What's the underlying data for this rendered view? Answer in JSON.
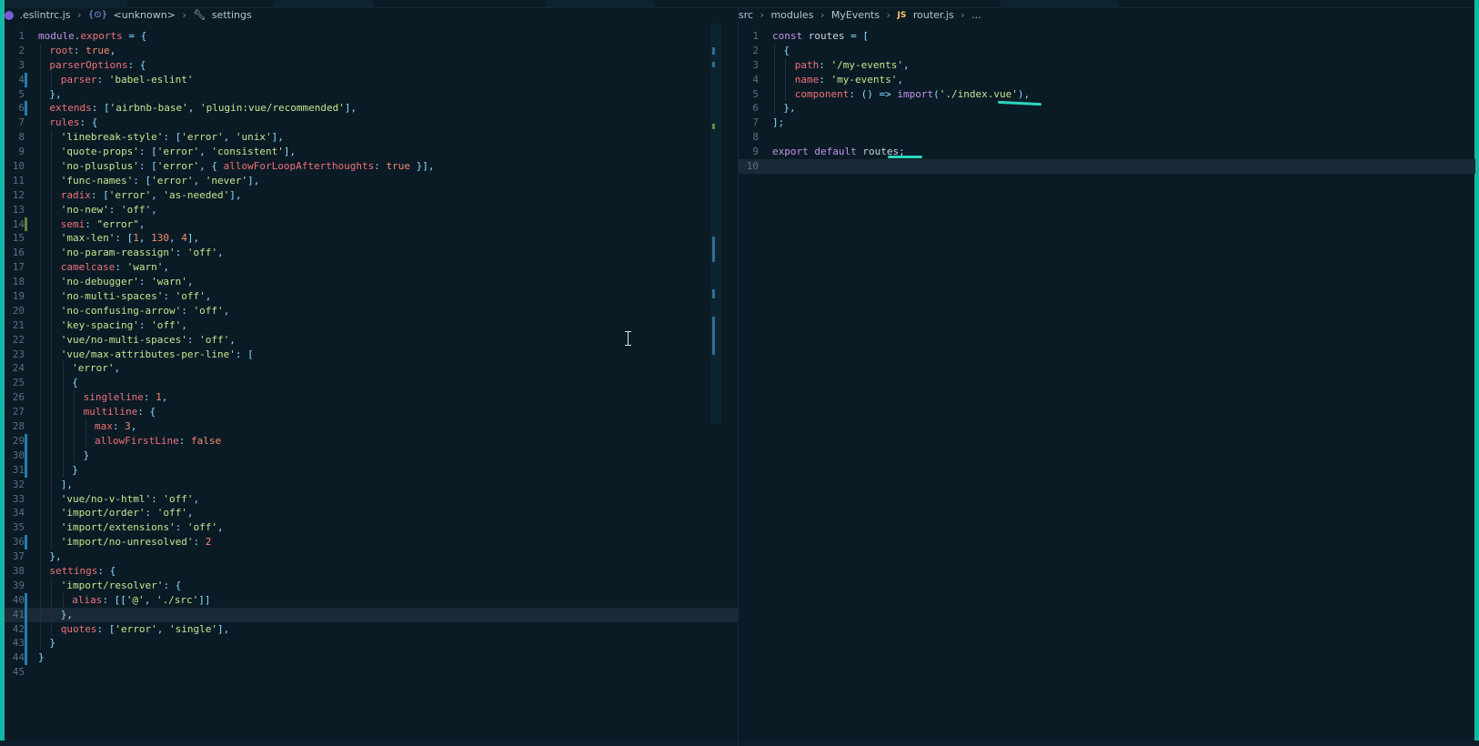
{
  "left_editor": {
    "breadcrumb": {
      "file": ".eslintrc.js",
      "symbol": "<unknown>",
      "subsymbol": "settings"
    },
    "lines": [
      {
        "num": "1",
        "indent": 0,
        "text": "module.exports = {"
      },
      {
        "num": "2",
        "indent": 1,
        "text": "root: true,"
      },
      {
        "num": "3",
        "indent": 1,
        "text": "parserOptions: {"
      },
      {
        "num": "4",
        "indent": 2,
        "text": "parser: 'babel-eslint'"
      },
      {
        "num": "5",
        "indent": 1,
        "text": "},"
      },
      {
        "num": "6",
        "indent": 1,
        "text": "extends: ['airbnb-base', 'plugin:vue/recommended'],"
      },
      {
        "num": "7",
        "indent": 1,
        "text": "rules: {"
      },
      {
        "num": "8",
        "indent": 2,
        "text": "'linebreak-style': ['error', 'unix'],"
      },
      {
        "num": "9",
        "indent": 2,
        "text": "'quote-props': ['error', 'consistent'],"
      },
      {
        "num": "10",
        "indent": 2,
        "text": "'no-plusplus': ['error', { allowForLoopAfterthoughts: true }],"
      },
      {
        "num": "11",
        "indent": 2,
        "text": "'func-names': ['error', 'never'],"
      },
      {
        "num": "12",
        "indent": 2,
        "text": "radix: ['error', 'as-needed'],"
      },
      {
        "num": "13",
        "indent": 2,
        "text": "'no-new': 'off',"
      },
      {
        "num": "14",
        "indent": 2,
        "text": "semi: \"error\","
      },
      {
        "num": "15",
        "indent": 2,
        "text": "'max-len': [1, 130, 4],"
      },
      {
        "num": "16",
        "indent": 2,
        "text": "'no-param-reassign': 'off',"
      },
      {
        "num": "17",
        "indent": 2,
        "text": "camelcase: 'warn',"
      },
      {
        "num": "18",
        "indent": 2,
        "text": "'no-debugger': 'warn',"
      },
      {
        "num": "19",
        "indent": 2,
        "text": "'no-multi-spaces': 'off',"
      },
      {
        "num": "20",
        "indent": 2,
        "text": "'no-confusing-arrow': 'off',"
      },
      {
        "num": "21",
        "indent": 2,
        "text": "'key-spacing': 'off',"
      },
      {
        "num": "22",
        "indent": 2,
        "text": "'vue/no-multi-spaces': 'off',"
      },
      {
        "num": "23",
        "indent": 2,
        "text": "'vue/max-attributes-per-line': ["
      },
      {
        "num": "24",
        "indent": 3,
        "text": "'error',"
      },
      {
        "num": "25",
        "indent": 3,
        "text": "{"
      },
      {
        "num": "26",
        "indent": 4,
        "text": "singleline: 1,"
      },
      {
        "num": "27",
        "indent": 4,
        "text": "multiline: {"
      },
      {
        "num": "28",
        "indent": 5,
        "text": "max: 3,"
      },
      {
        "num": "29",
        "indent": 5,
        "text": "allowFirstLine: false"
      },
      {
        "num": "30",
        "indent": 4,
        "text": "}"
      },
      {
        "num": "31",
        "indent": 3,
        "text": "}"
      },
      {
        "num": "32",
        "indent": 2,
        "text": "],"
      },
      {
        "num": "33",
        "indent": 2,
        "text": "'vue/no-v-html': 'off',"
      },
      {
        "num": "34",
        "indent": 2,
        "text": "'import/order': 'off',"
      },
      {
        "num": "35",
        "indent": 2,
        "text": "'import/extensions': 'off',"
      },
      {
        "num": "36",
        "indent": 2,
        "text": "'import/no-unresolved': 2"
      },
      {
        "num": "37",
        "indent": 1,
        "text": "},"
      },
      {
        "num": "38",
        "indent": 1,
        "text": "settings: {"
      },
      {
        "num": "39",
        "indent": 2,
        "text": "'import/resolver': {"
      },
      {
        "num": "40",
        "indent": 3,
        "text": "alias: [['@', './src']]"
      },
      {
        "num": "41",
        "indent": 2,
        "text": "},"
      },
      {
        "num": "42",
        "indent": 2,
        "text": "quotes: ['error', 'single'],"
      },
      {
        "num": "43",
        "indent": 1,
        "text": "}"
      },
      {
        "num": "44",
        "indent": 0,
        "text": "}"
      },
      {
        "num": "45",
        "indent": 0,
        "text": ""
      }
    ],
    "current_line": "41"
  },
  "right_editor": {
    "breadcrumb": {
      "path": [
        "src",
        "modules",
        "MyEvents"
      ],
      "file_badge": "JS",
      "file": "router.js",
      "tail": "..."
    },
    "lines": [
      {
        "num": "1",
        "indent": 0,
        "text": "const routes = ["
      },
      {
        "num": "2",
        "indent": 1,
        "text": "{"
      },
      {
        "num": "3",
        "indent": 2,
        "text": "path: '/my-events',"
      },
      {
        "num": "4",
        "indent": 2,
        "text": "name: 'my-events',"
      },
      {
        "num": "5",
        "indent": 2,
        "text": "component: () => import('./index.vue'),"
      },
      {
        "num": "6",
        "indent": 1,
        "text": "},"
      },
      {
        "num": "7",
        "indent": 0,
        "text": "];"
      },
      {
        "num": "8",
        "indent": 0,
        "text": ""
      },
      {
        "num": "9",
        "indent": 0,
        "text": "export default routes;"
      },
      {
        "num": "10",
        "indent": 0,
        "text": ""
      }
    ],
    "current_line": "10"
  },
  "colors": {
    "background": "#0a1b26",
    "accent_edge": "#14b8a6",
    "keyword": "#c792ea",
    "property": "#f07178",
    "string": "#c3e88d",
    "number": "#f78c6c",
    "punctuation": "#89ddff",
    "function": "#82aaff",
    "annotation": "#2dd4bf"
  },
  "icons": [
    "eslint-file-icon",
    "symbol-icon",
    "wrench-icon",
    "chevron-right-icon",
    "js-file-icon",
    "text-cursor-icon"
  ]
}
